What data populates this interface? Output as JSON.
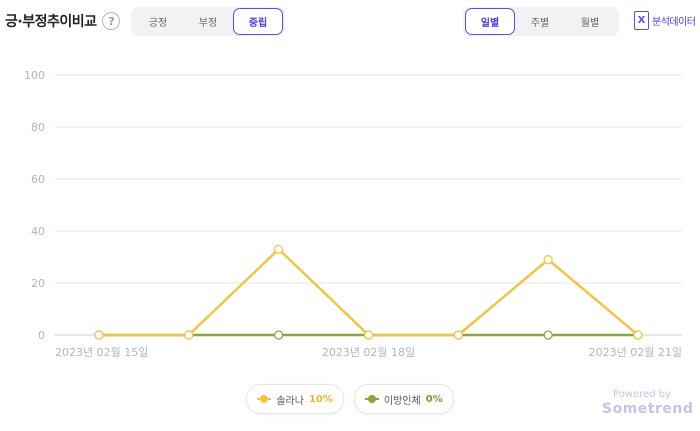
{
  "header": {
    "title": "긍·부정추이비교",
    "help": "?",
    "sentiment_tabs": [
      {
        "label": "긍정",
        "active": false
      },
      {
        "label": "부정",
        "active": false
      },
      {
        "label": "중립",
        "active": true
      }
    ],
    "period_tabs": [
      {
        "label": "일별",
        "active": true
      },
      {
        "label": "주별",
        "active": false
      },
      {
        "label": "월별",
        "active": false
      }
    ],
    "export_icon": "excel-icon",
    "export_label": "분석데이터"
  },
  "chart_data": {
    "type": "line",
    "title": "",
    "xlabel": "",
    "ylabel": "",
    "ylim": [
      0,
      100
    ],
    "yticks": [
      0,
      20,
      40,
      60,
      80,
      100
    ],
    "x": [
      "2023-02-15",
      "2023-02-16",
      "2023-02-17",
      "2023-02-18",
      "2023-02-19",
      "2023-02-20",
      "2023-02-21"
    ],
    "x_tick_labels": [
      {
        "index": 0,
        "label": "2023년 02월 15일"
      },
      {
        "index": 3,
        "label": "2023년 02월 18일"
      },
      {
        "index": 6,
        "label": "2023년 02월 21일"
      }
    ],
    "series": [
      {
        "name": "솔라나",
        "share": "10%",
        "color": "#f2c442",
        "values": [
          0,
          0,
          33,
          0,
          0,
          29,
          0
        ]
      },
      {
        "name": "이방인체",
        "share": "0%",
        "color": "#8ca63a",
        "values": [
          0,
          0,
          0,
          0,
          0,
          0,
          0
        ]
      }
    ],
    "grid": true,
    "legend_position": "bottom"
  },
  "footer": {
    "powered_by": "Powered by",
    "brand": "Sometrend",
    "brand_color": "#c6c2ee"
  }
}
